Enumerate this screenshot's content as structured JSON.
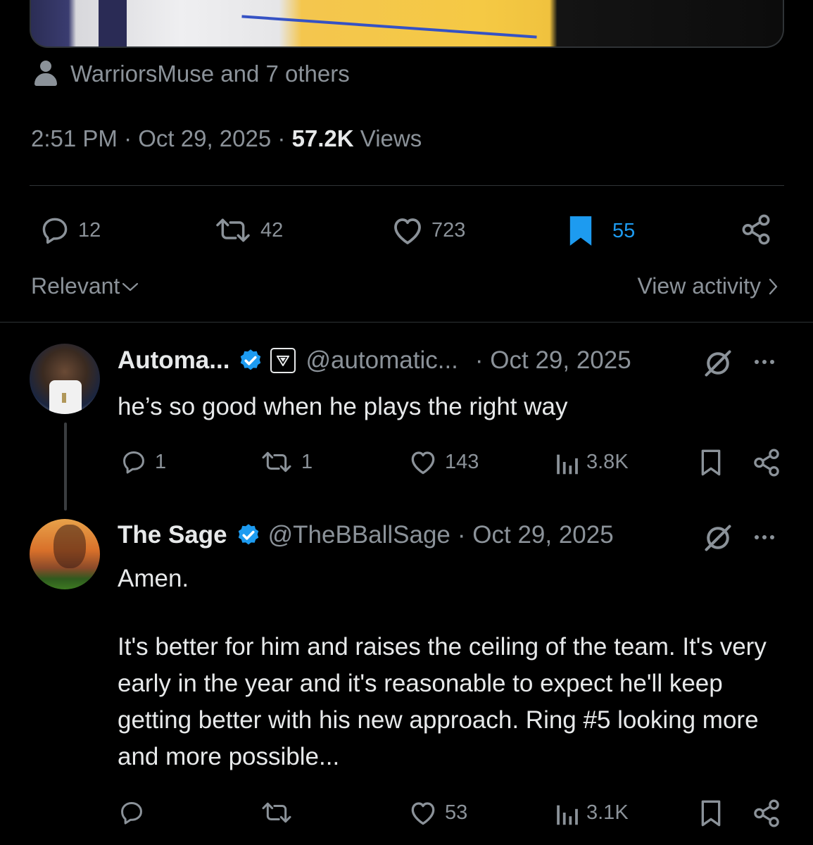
{
  "tweet": {
    "likers_text": "WarriorsMuse and 7 others",
    "time": "2:51 PM",
    "date": "Oct 29, 2025",
    "views_count": "57.2K",
    "views_label": "Views",
    "actions": {
      "replies": "12",
      "reposts": "42",
      "likes": "723",
      "bookmarks": "55"
    },
    "sort_label": "Relevant",
    "view_activity_label": "View activity"
  },
  "replies": [
    {
      "name": "Automa...",
      "handle": "@automatic...",
      "date": "· Oct 29, 2025",
      "text": "he’s so good when he plays the right way",
      "replies": "1",
      "reposts": "1",
      "likes": "143",
      "views": "3.8K"
    },
    {
      "name": "The Sage",
      "handle": "@TheBBallSage",
      "date": "· Oct 29, 2025",
      "text_first": "Amen.",
      "text_body": "It's better for him and raises the ceiling of the team. It's very early in the year and it's reasonable to expect he'll keep getting better with his new approach. Ring #5 looking more and more possible...",
      "likes": "53",
      "views": "3.1K"
    }
  ],
  "colors": {
    "background": "#000000",
    "text": "#e7e9ea",
    "muted": "#8b9299",
    "accent": "#1d9bf0",
    "divider": "#2f3336"
  },
  "icons": [
    "person-icon",
    "reply-icon",
    "repost-icon",
    "like-icon",
    "bookmark-icon",
    "share-icon",
    "chevron-down-icon",
    "chevron-right-icon",
    "verified-badge-icon",
    "affiliate-badge-icon",
    "grok-icon",
    "more-icon",
    "views-icon"
  ]
}
